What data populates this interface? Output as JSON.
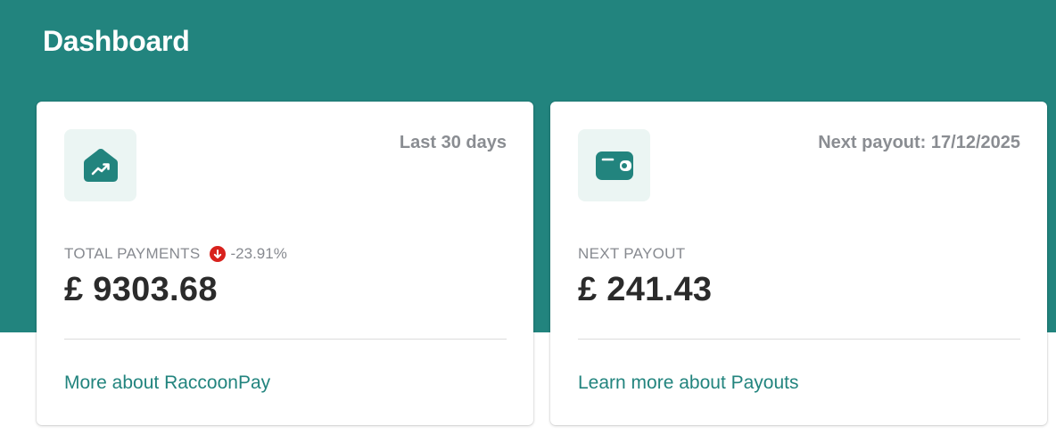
{
  "header": {
    "title": "Dashboard",
    "background_color": "#22847e"
  },
  "cards": [
    {
      "icon": "trending-up-icon",
      "meta": "Last 30 days",
      "label": "TOTAL PAYMENTS",
      "change": {
        "direction": "down",
        "icon": "arrow-down-icon",
        "value": "-23.91%",
        "color": "#d8221d"
      },
      "value": "£ 9303.68",
      "link": "More about RaccoonPay"
    },
    {
      "icon": "wallet-icon",
      "meta": "Next payout: 17/12/2025",
      "label": "NEXT PAYOUT",
      "value": "£ 241.43",
      "link": "Learn more about Payouts"
    }
  ],
  "colors": {
    "accent": "#22847e",
    "icon_tile_bg": "#ebf5f3",
    "negative": "#d8221d"
  }
}
